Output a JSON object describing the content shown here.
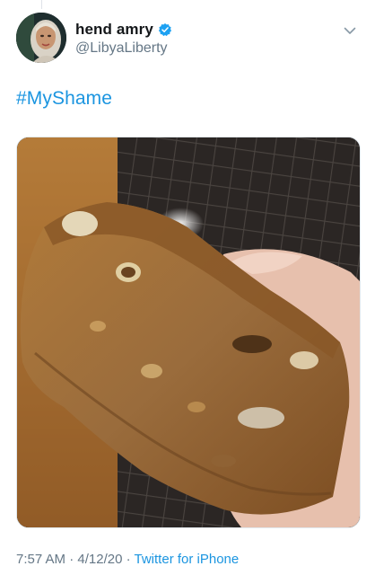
{
  "tweet": {
    "user": {
      "display_name": "hend amry",
      "handle": "@LibyaLiberty",
      "verified": true,
      "avatar_icon": "profile-photo-woman-hijab"
    },
    "menu_icon": "chevron-down-icon",
    "text": "#MyShame",
    "media": {
      "icon": "photo-banana-bread-slice"
    },
    "meta": {
      "time": "7:57 AM",
      "separator": "·",
      "date": "4/12/20",
      "source": "Twitter for iPhone"
    }
  },
  "colors": {
    "link": "#1b95e0",
    "secondary_text": "#657786",
    "primary_text": "#14171a",
    "verified_badge": "#1da1f2"
  }
}
